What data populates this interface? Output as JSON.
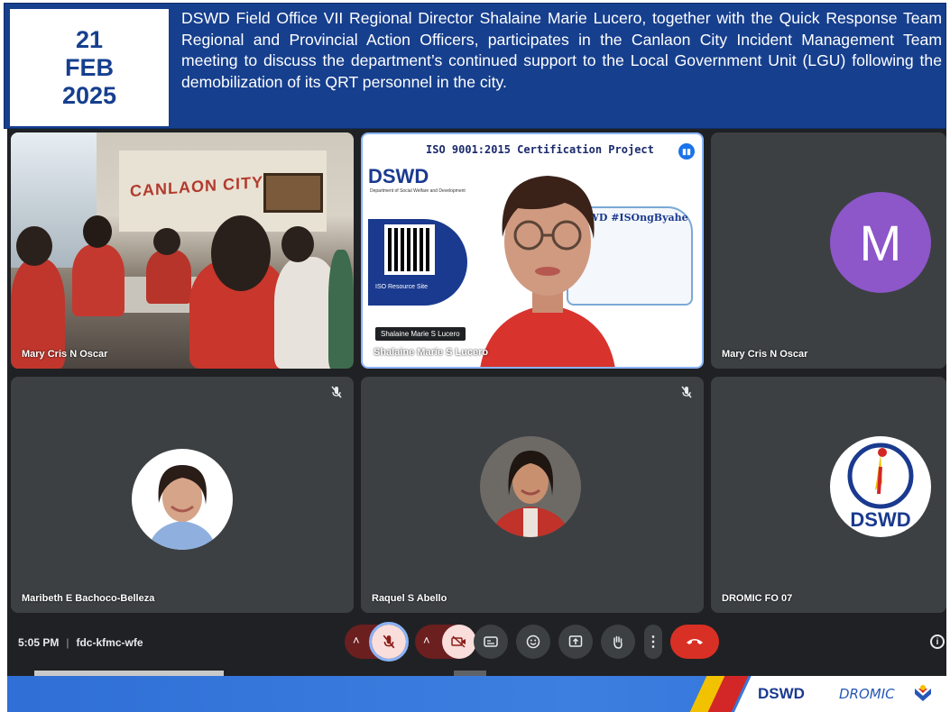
{
  "header": {
    "date_day": "21",
    "date_month": "FEB",
    "date_year": "2025",
    "headline": "DSWD Field Office VII Regional Director Shalaine Marie Lucero, together with the Quick Response Team Regional and Provincial Action Officers, participates in the Canlaon City Incident Management Team meeting to discuss the department’s continued support to the Local Government Unit (LGU) following the demobilization of its QRT personnel in the city."
  },
  "meeting": {
    "time": "5:05 PM",
    "code": "fdc-kfmc-wfe",
    "tiles": [
      {
        "name": "Mary Cris N Oscar"
      },
      {
        "name": "Shalaine Marie S Lucero",
        "name_tag": "Shalaine Marie S Lucero",
        "slide_title": "ISO 9001:2015 Certification Project",
        "slide_logo": "DSWD",
        "slide_logo_sub": "Department of Social Welfare and Development",
        "qr_label": "ISO Resource Site",
        "bus_text": "DSWD #ISOngByahe"
      },
      {
        "name": "Mary Cris N Oscar",
        "avatar_letter": "M"
      },
      {
        "name": "Maribeth E Bachoco-Belleza"
      },
      {
        "name": "Raquel S Abello"
      },
      {
        "name": "DROMIC FO 07",
        "logo_text": "DSWD"
      }
    ],
    "room_sign": "CANLAON CITY"
  },
  "controls": {
    "icons": [
      "chevron-up-icon",
      "mic-off-icon",
      "chevron-up-icon",
      "camera-off-icon",
      "captions-icon",
      "emoji-icon",
      "present-icon",
      "raise-hand-icon",
      "more-icon",
      "end-call-icon",
      "info-icon"
    ],
    "info_glyph": "i",
    "more_glyph": "⋮",
    "chevron_glyph": "˄"
  },
  "footer": {
    "logo_dswd": "DSWD",
    "logo_dromic": "DROMIC"
  },
  "colors": {
    "header_blue": "#163f8e",
    "meet_bg": "#202124",
    "tile_bg": "#3c4043",
    "end_call_red": "#d93025",
    "avatar_purple": "#8d56c9"
  }
}
